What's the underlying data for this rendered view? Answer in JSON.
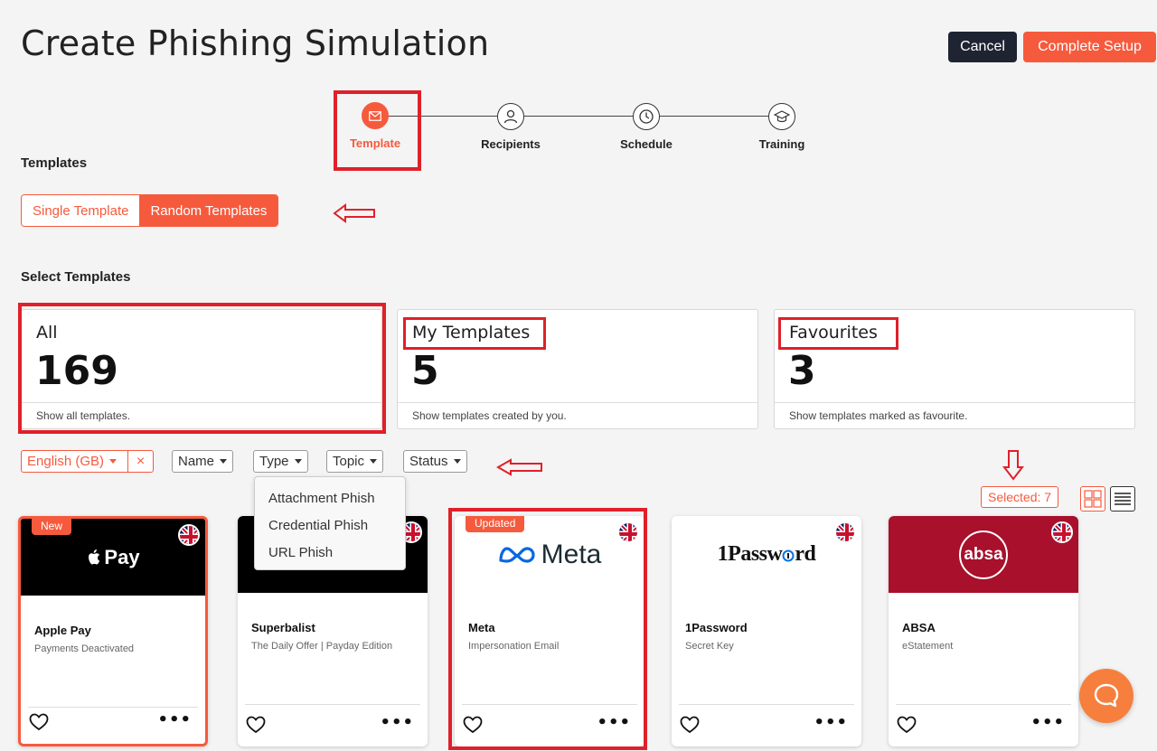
{
  "header": {
    "title": "Create Phishing Simulation",
    "cancel_label": "Cancel",
    "complete_label": "Complete Setup"
  },
  "stepper": {
    "steps": [
      {
        "label": "Template",
        "icon": "envelope-icon",
        "active": true
      },
      {
        "label": "Recipients",
        "icon": "user-icon",
        "active": false
      },
      {
        "label": "Schedule",
        "icon": "clock-icon",
        "active": false
      },
      {
        "label": "Training",
        "icon": "graduation-cap-icon",
        "active": false
      }
    ]
  },
  "templates_section": {
    "heading": "Templates",
    "mode_options": [
      "Single Template",
      "Random Templates"
    ],
    "selected_mode": "Random Templates"
  },
  "select_section": {
    "heading": "Select Templates",
    "stats": [
      {
        "label": "All",
        "count": "169",
        "footer": "Show all templates."
      },
      {
        "label": "My Templates",
        "count": "5",
        "footer": "Show templates created by you."
      },
      {
        "label": "Favourites",
        "count": "3",
        "footer": "Show templates marked as favourite."
      }
    ]
  },
  "filters": {
    "language": "English (GB)",
    "clear": "×",
    "name": "Name",
    "type": "Type",
    "topic": "Topic",
    "status": "Status",
    "type_options": [
      "Attachment Phish",
      "Credential Phish",
      "URL Phish"
    ]
  },
  "selection": {
    "selected_label": "Selected: 7"
  },
  "cards": [
    {
      "name": "Apple Pay",
      "subtitle": "Payments Deactivated",
      "ribbon": "New",
      "logo": "Pay",
      "bg": "#000000"
    },
    {
      "name": "Superbalist",
      "subtitle": "The Daily Offer | Payday Edition",
      "ribbon": "",
      "logo": "",
      "bg": "#000000"
    },
    {
      "name": "Meta",
      "subtitle": "Impersonation Email",
      "ribbon": "Updated",
      "logo": "Meta",
      "bg": "#ffffff"
    },
    {
      "name": "1Password",
      "subtitle": "Secret Key",
      "ribbon": "",
      "logo": "1Passw",
      "logo_tail": "rd",
      "bg": "#ffffff"
    },
    {
      "name": "ABSA",
      "subtitle": "eStatement",
      "ribbon": "",
      "logo": "absa",
      "bg": "#a8102c"
    }
  ],
  "colors": {
    "accent": "#f65a3d",
    "dark": "#1f2433",
    "annotation": "#e0202a"
  }
}
